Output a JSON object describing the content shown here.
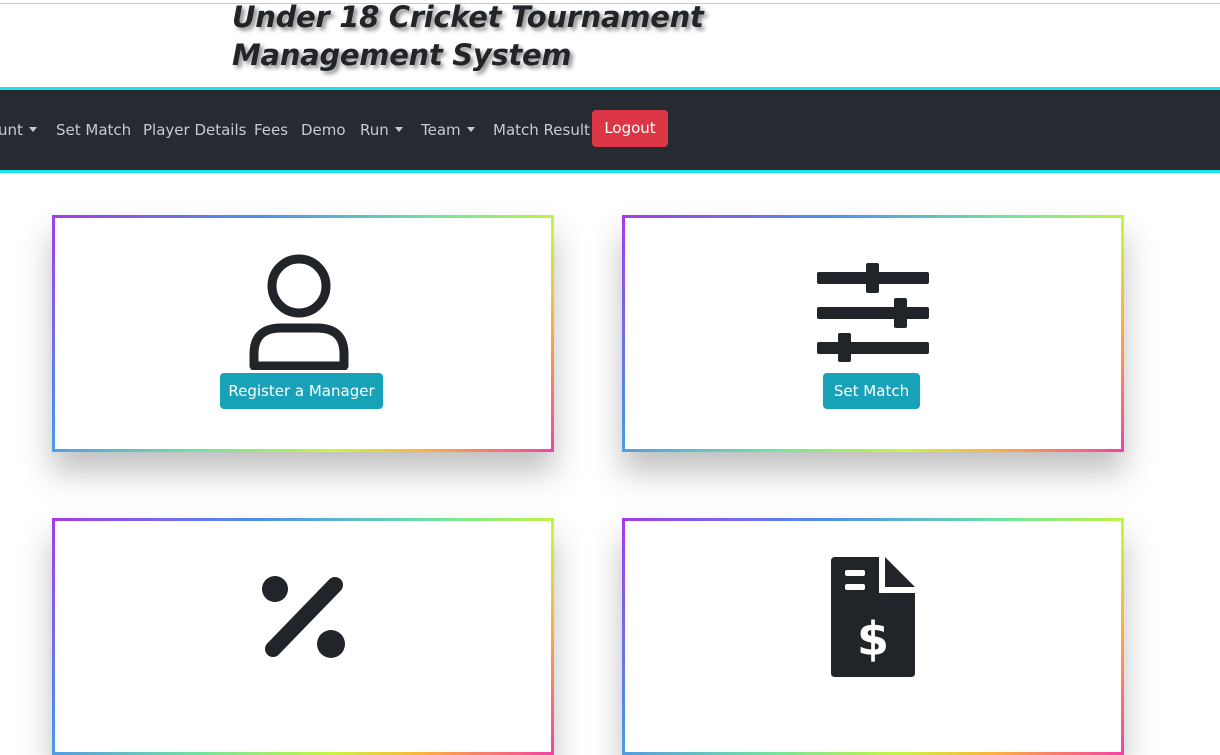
{
  "header": {
    "title": "Under 18 Cricket Tournament Management System"
  },
  "navbar": {
    "items": [
      {
        "label": "unt",
        "dropdown": true
      },
      {
        "label": "Set Match",
        "dropdown": false
      },
      {
        "label": "Player Details",
        "dropdown": false
      },
      {
        "label": "Fees",
        "dropdown": false
      },
      {
        "label": "Demo",
        "dropdown": false
      },
      {
        "label": "Run",
        "dropdown": true
      },
      {
        "label": "Team",
        "dropdown": true
      },
      {
        "label": "Match Result",
        "dropdown": false
      }
    ],
    "logout_label": "Logout"
  },
  "cards": [
    {
      "icon": "user-icon",
      "button_label": "Register a Manager"
    },
    {
      "icon": "sliders-icon",
      "button_label": "Set Match"
    },
    {
      "icon": "percent-icon",
      "button_label": ""
    },
    {
      "icon": "invoice-dollar-icon",
      "button_label": ""
    }
  ],
  "colors": {
    "navbar_bg": "#262b32",
    "navbar_border": "#19e4ee",
    "logout_bg": "#dc3545",
    "card_button_bg": "#17a2b8",
    "icon_color": "#212529"
  }
}
